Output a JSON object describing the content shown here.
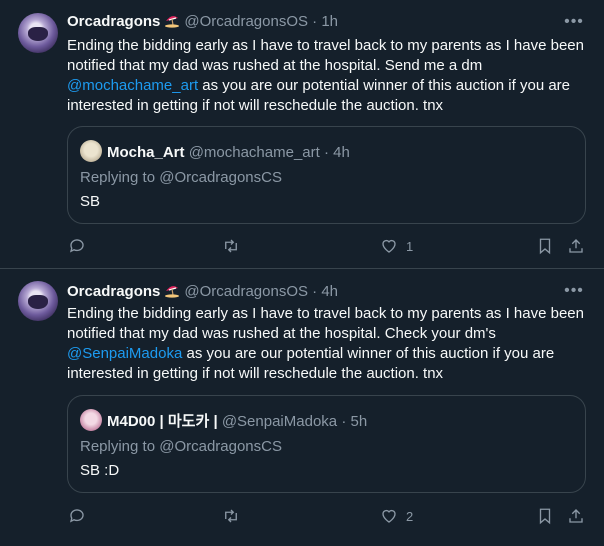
{
  "tweets": [
    {
      "author_name": "Orcadragons",
      "handle": "@OrcadragonsOS",
      "time": "· 1h",
      "emoji": "beach-umbrella-icon",
      "text_before": "Ending the bidding early as I have to travel back to my parents as I have been notified that my dad was rushed at the hospital. Send me a dm ",
      "mention": "@mochachame_art",
      "text_after": " as you are our potential winner of this auction if you are interested in getting if not will reschedule the auction. tnx",
      "quote": {
        "author_name": "Mocha_Art",
        "handle": "@mochachame_art",
        "time": "· 4h",
        "replying": "Replying to @OrcadragonsCS",
        "text": "SB"
      },
      "like_count": "1"
    },
    {
      "author_name": "Orcadragons",
      "handle": "@OrcadragonsOS",
      "time": "· 4h",
      "emoji": "beach-umbrella-icon",
      "text_before": "Ending the bidding early as I have to travel back to my parents as I have been notified that my dad was rushed at the hospital. Check your dm's ",
      "mention": "@SenpaiMadoka",
      "text_after": " as you are our potential winner of this auction if you are interested in getting if not will reschedule the auction. tnx",
      "quote": {
        "author_name": "M4D00 | 마도카 |",
        "handle": "@SenpaiMadoka",
        "time": "· 5h",
        "replying": "Replying to @OrcadragonsCS",
        "text": "SB :D"
      },
      "like_count": "2"
    }
  ],
  "colors": {
    "background": "#15202b",
    "border": "#38444d",
    "muted": "#8b98a5",
    "link": "#1d9bf0",
    "text": "#f7f9f9"
  }
}
